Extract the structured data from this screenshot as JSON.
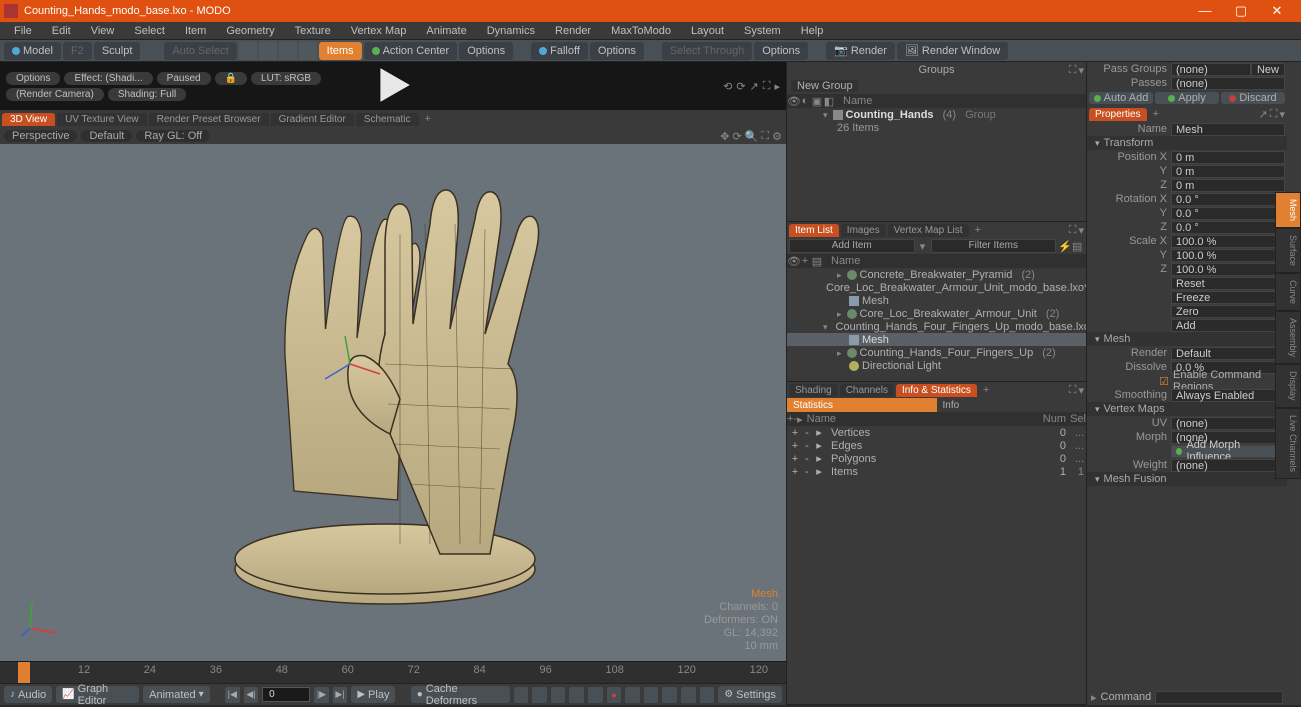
{
  "app": {
    "title": "Counting_Hands_modo_base.lxo - MODO",
    "name": "MODO"
  },
  "menu": [
    "File",
    "Edit",
    "View",
    "Select",
    "Item",
    "Geometry",
    "Texture",
    "Vertex Map",
    "Animate",
    "Dynamics",
    "Render",
    "MaxToModo",
    "Layout",
    "System",
    "Help"
  ],
  "toolbar": {
    "model": "Model",
    "model_key": "F2",
    "sculpt": "Sculpt",
    "auto_select": "Auto Select",
    "items": "Items",
    "action_center": "Action Center",
    "options1": "Options",
    "falloff": "Falloff",
    "options2": "Options",
    "select_through": "Select Through",
    "options3": "Options",
    "render": "Render",
    "render_window": "Render Window"
  },
  "preview": {
    "options": "Options",
    "effect": "Effect: (Shadi...",
    "paused": "Paused",
    "lock_icon": "lock",
    "lut": "LUT: sRGB",
    "render_cam": "(Render Camera)",
    "shading": "Shading: Full"
  },
  "view_tabs": [
    "3D View",
    "UV Texture View",
    "Render Preset Browser",
    "Gradient Editor",
    "Schematic"
  ],
  "viewport_opts": {
    "perspective": "Perspective",
    "default": "Default",
    "raygl": "Ray GL: Off"
  },
  "viewport_info": {
    "mesh": "Mesh",
    "channels": "Channels: 0",
    "deformers": "Deformers: ON",
    "gl": "GL: 14,392",
    "scale": "10 mm"
  },
  "timeline": {
    "ticks": [
      "0",
      "12",
      "24",
      "36",
      "48",
      "60",
      "72",
      "84",
      "96",
      "108",
      "120",
      "120"
    ],
    "current_frame": "0"
  },
  "playbar": {
    "audio": "Audio",
    "graph": "Graph Editor",
    "animated": "Animated",
    "play": "Play",
    "cache": "Cache Deformers",
    "settings": "Settings"
  },
  "groups": {
    "title": "Groups",
    "new_group": "New Group",
    "name_col": "Name",
    "root": "Counting_Hands",
    "root_count": "(4)",
    "root_type": "Group",
    "items_count": "26 Items"
  },
  "item_list": {
    "tabs": [
      "Item List",
      "Images",
      "Vertex Map List"
    ],
    "add": "Add Item",
    "filter": "Filter Items",
    "name_col": "Name",
    "rows": [
      {
        "t": "scene",
        "n": "Concrete_Breakwater_Pyramid",
        "c": "(2)"
      },
      {
        "t": "scene",
        "n": "Core_Loc_Breakwater_Armour_Unit_modo_base.lxo*",
        "c": ""
      },
      {
        "t": "mesh",
        "n": "Mesh",
        "c": ""
      },
      {
        "t": "item",
        "n": "Core_Loc_Breakwater_Armour_Unit",
        "c": "(2)"
      },
      {
        "t": "scene",
        "n": "Counting_Hands_Four_Fingers_Up_modo_base.lxo*",
        "c": ""
      },
      {
        "t": "mesh-sel",
        "n": "Mesh",
        "c": ""
      },
      {
        "t": "item",
        "n": "Counting_Hands_Four_Fingers_Up",
        "c": "(2)"
      },
      {
        "t": "light",
        "n": "Directional Light",
        "c": ""
      }
    ]
  },
  "info_stats": {
    "tabs": [
      "Shading",
      "Channels",
      "Info & Statistics"
    ],
    "sub_stat": "Statistics",
    "sub_info": "Info",
    "cols": {
      "name": "Name",
      "num": "Num",
      "sel": "Sel"
    },
    "rows": [
      {
        "n": "Vertices",
        "num": "0",
        "sel": "..."
      },
      {
        "n": "Edges",
        "num": "0",
        "sel": "..."
      },
      {
        "n": "Polygons",
        "num": "0",
        "sel": "..."
      },
      {
        "n": "Items",
        "num": "1",
        "sel": "1"
      }
    ]
  },
  "props": {
    "pass_groups": "Pass Groups",
    "pg_val": "(none)",
    "new": "New",
    "passes": "Passes",
    "p_val": "(none)",
    "auto_add": "Auto Add",
    "apply": "Apply",
    "discard": "Discard",
    "properties_tab": "Properties",
    "name_lbl": "Name",
    "name_val": "Mesh",
    "transform": "Transform",
    "pos": "Position X",
    "pos_x": "0 m",
    "pos_y": "0 m",
    "pos_z": "0 m",
    "Y": "Y",
    "Z": "Z",
    "rot": "Rotation X",
    "rot_x": "0.0 °",
    "rot_y": "0.0 °",
    "rot_z": "0.0 °",
    "scl": "Scale X",
    "scl_x": "100.0 %",
    "scl_y": "100.0 %",
    "scl_z": "100.0 %",
    "reset": "Reset",
    "freeze": "Freeze",
    "zero": "Zero",
    "add": "Add",
    "mesh_sec": "Mesh",
    "render_lbl": "Render",
    "render_val": "Default",
    "dissolve_lbl": "Dissolve",
    "dissolve_val": "0.0 %",
    "cmd_regions": "Enable Command Regions",
    "smoothing_lbl": "Smoothing",
    "smoothing_val": "Always Enabled",
    "vmaps": "Vertex Maps",
    "uv_lbl": "UV",
    "uv_val": "(none)",
    "morph_lbl": "Morph",
    "morph_val": "(none)",
    "add_morph": "Add Morph Influence",
    "weight_lbl": "Weight",
    "weight_val": "(none)",
    "fusion": "Mesh Fusion",
    "side": [
      "Mesh",
      "Surface",
      "Curve",
      "Assembly",
      "Display",
      "Live Channels"
    ],
    "command": "Command"
  }
}
